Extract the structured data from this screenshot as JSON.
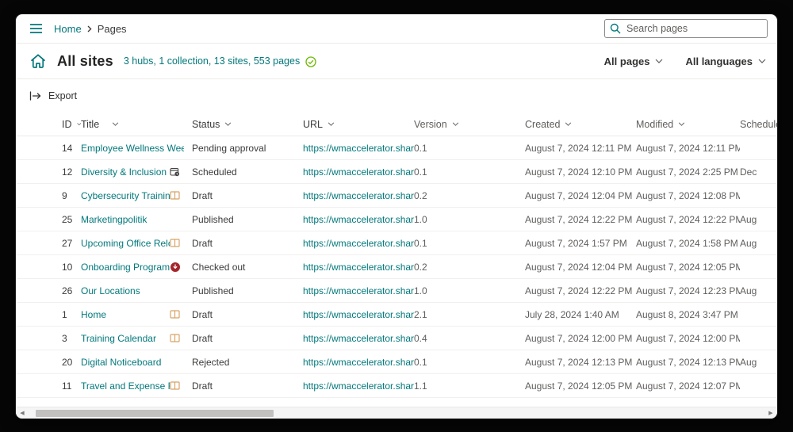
{
  "topbar": {
    "breadcrumb": {
      "home": "Home",
      "current": "Pages"
    },
    "search_placeholder": "Search pages"
  },
  "header": {
    "title": "All sites",
    "stats": "3 hubs, 1 collection, 13 sites, 553 pages",
    "filters": {
      "pages": "All pages",
      "languages": "All languages"
    }
  },
  "toolbar": {
    "export_label": "Export"
  },
  "table": {
    "columns": [
      "ID",
      "Title",
      "Status",
      "URL",
      "Version",
      "Created",
      "Modified",
      "Scheduled"
    ],
    "rows": [
      {
        "id": "14",
        "title": "Employee Wellness Week",
        "title_icon": "",
        "status": "Pending approval",
        "url": "https://wmaccelerator.sharepoin...",
        "version": "0.1",
        "created": "August 7, 2024 12:11 PM",
        "modified": "August 7, 2024 12:11 PM",
        "scheduled": ""
      },
      {
        "id": "12",
        "title": "Diversity & Inclusion Initiatives",
        "title_icon": "scheduled-icon",
        "status": "Scheduled",
        "url": "https://wmaccelerator.sharepoin...",
        "version": "0.1",
        "created": "August 7, 2024 12:10 PM",
        "modified": "August 7, 2024 2:25 PM",
        "scheduled": "Dec"
      },
      {
        "id": "9",
        "title": "Cybersecurity Training",
        "title_icon": "book-icon",
        "status": "Draft",
        "url": "https://wmaccelerator.sharepoin...",
        "version": "0.2",
        "created": "August 7, 2024 12:04 PM",
        "modified": "August 7, 2024 12:08 PM",
        "scheduled": ""
      },
      {
        "id": "25",
        "title": "Marketingpolitik",
        "title_icon": "",
        "status": "Published",
        "url": "https://wmaccelerator.sharepoin...",
        "version": "1.0",
        "created": "August 7, 2024 12:22 PM",
        "modified": "August 7, 2024 12:22 PM",
        "scheduled": "Aug"
      },
      {
        "id": "27",
        "title": "Upcoming Office Relocation",
        "title_icon": "book-icon",
        "status": "Draft",
        "url": "https://wmaccelerator.sharepoin...",
        "version": "0.1",
        "created": "August 7, 2024 1:57 PM",
        "modified": "August 7, 2024 1:58 PM",
        "scheduled": "Aug"
      },
      {
        "id": "10",
        "title": "Onboarding Program",
        "title_icon": "blocked-icon",
        "status": "Checked out",
        "url": "https://wmaccelerator.sharepoin...",
        "version": "0.2",
        "created": "August 7, 2024 12:04 PM",
        "modified": "August 7, 2024 12:05 PM",
        "scheduled": ""
      },
      {
        "id": "26",
        "title": "Our Locations",
        "title_icon": "",
        "status": "Published",
        "url": "https://wmaccelerator.sharepoin...",
        "version": "1.0",
        "created": "August 7, 2024 12:22 PM",
        "modified": "August 7, 2024 12:23 PM",
        "scheduled": "Aug"
      },
      {
        "id": "1",
        "title": "Home",
        "title_icon": "book-icon",
        "status": "Draft",
        "url": "https://wmaccelerator.sharepoin...",
        "version": "2.1",
        "created": "July 28, 2024 1:40 AM",
        "modified": "August 8, 2024 3:47 PM",
        "scheduled": ""
      },
      {
        "id": "3",
        "title": "Training Calendar",
        "title_icon": "book-icon",
        "status": "Draft",
        "url": "https://wmaccelerator.sharepoin...",
        "version": "0.4",
        "created": "August 7, 2024 12:00 PM",
        "modified": "August 7, 2024 12:00 PM",
        "scheduled": ""
      },
      {
        "id": "20",
        "title": "Digital Noticeboard",
        "title_icon": "",
        "status": "Rejected",
        "url": "https://wmaccelerator.sharepoin...",
        "version": "0.1",
        "created": "August 7, 2024 12:13 PM",
        "modified": "August 7, 2024 12:13 PM",
        "scheduled": "Aug"
      },
      {
        "id": "11",
        "title": "Travel and Expense Resources",
        "title_icon": "book-icon",
        "status": "Draft",
        "url": "https://wmaccelerator.sharepoin...",
        "version": "1.1",
        "created": "August 7, 2024 12:05 PM",
        "modified": "August 7, 2024 12:07 PM",
        "scheduled": ""
      }
    ]
  },
  "colors": {
    "accent_teal": "#03787c",
    "check_green": "#6bb700",
    "book_icon_orange": "#d8a466",
    "blocked_red": "#a4262c",
    "text_dark": "#323130",
    "text_gray": "#605e5c"
  }
}
